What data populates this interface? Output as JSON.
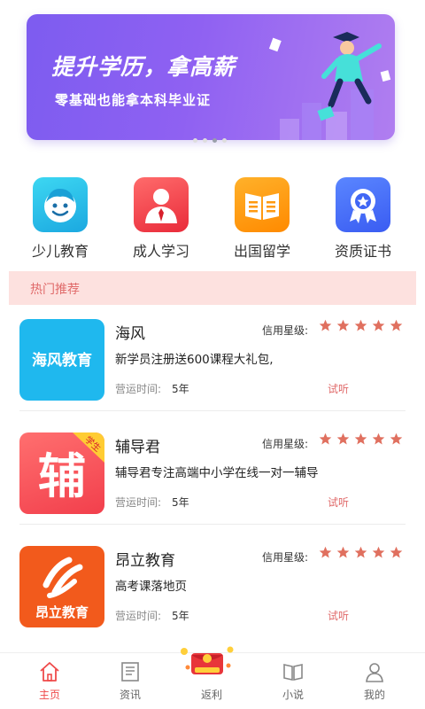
{
  "banner": {
    "title": "提升学历，拿高薪",
    "subtitle": "零基础也能拿本科毕业证",
    "slides": 4,
    "active_slide": 3
  },
  "categories": [
    {
      "label": "少儿教育",
      "icon": "smiley-face-icon",
      "color": "#21b6e6"
    },
    {
      "label": "成人学习",
      "icon": "businessman-icon",
      "color": "#ee3b45"
    },
    {
      "label": "出国留学",
      "icon": "open-book-icon",
      "color": "#ff9a10"
    },
    {
      "label": "资质证书",
      "icon": "award-medal-icon",
      "color": "#4066f5"
    }
  ],
  "section": {
    "title": "热门推荐"
  },
  "listings": [
    {
      "name": "海风",
      "logo_text": "海风教育",
      "rating_label": "信用星级:",
      "stars": 5,
      "description": "新学员注册送600课程大礼包,",
      "operation_label": "营运时间:",
      "operation_value": "5年",
      "action": "试听"
    },
    {
      "name": "辅导君",
      "logo_text": "辅",
      "logo_badge": "学生",
      "rating_label": "信用星级:",
      "stars": 5,
      "description": "辅导君专注高端中小学在线一对一辅导",
      "operation_label": "营运时间:",
      "operation_value": "5年",
      "action": "试听"
    },
    {
      "name": "昂立教育",
      "logo_text": "昂立教育",
      "rating_label": "信用星级:",
      "stars": 5,
      "description": "高考课落地页",
      "operation_label": "营运时间:",
      "operation_value": "5年",
      "action": "试听"
    }
  ],
  "tabs": [
    {
      "label": "主页",
      "icon": "home-icon",
      "active": true
    },
    {
      "label": "资讯",
      "icon": "news-icon",
      "active": false
    },
    {
      "label": "返利",
      "icon": "gift-red-envelope-icon",
      "active": false
    },
    {
      "label": "小说",
      "icon": "book-icon",
      "active": false
    },
    {
      "label": "我的",
      "icon": "user-icon",
      "active": false
    }
  ],
  "colors": {
    "accent": "#ef4a4a",
    "star": "#e0705f",
    "section_bg": "#fde1df"
  }
}
